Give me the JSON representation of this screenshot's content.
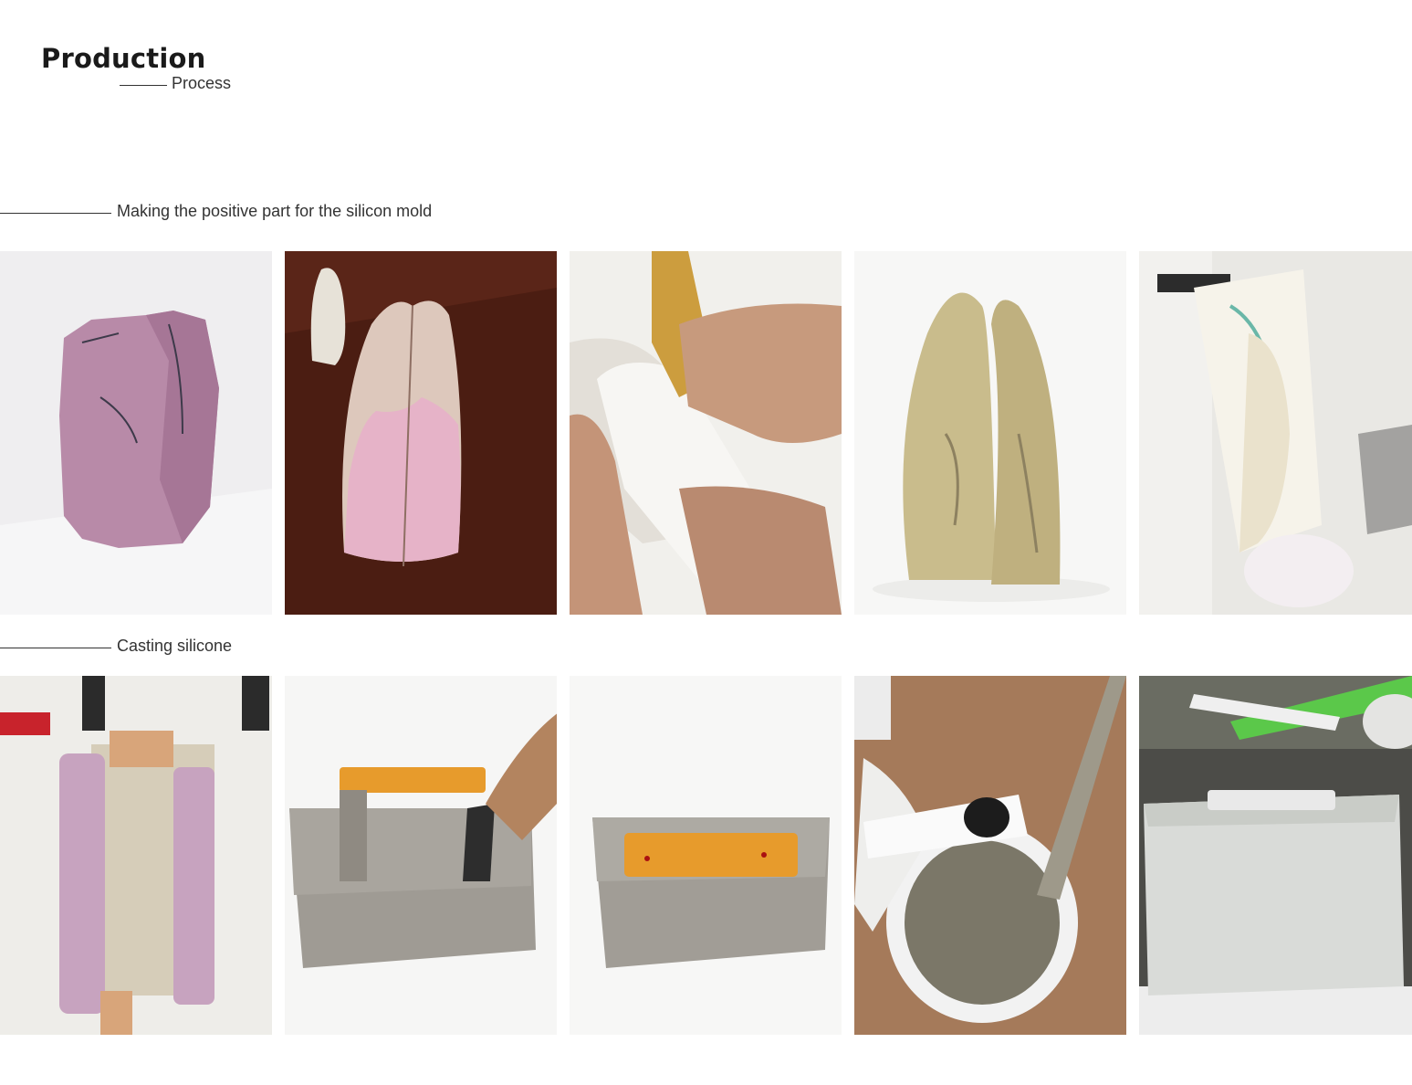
{
  "header": {
    "title": "Production",
    "subtitle": "Process"
  },
  "sections": [
    {
      "label": "Making the positive part for the silicon mold"
    },
    {
      "label": "Casting silicone"
    }
  ]
}
